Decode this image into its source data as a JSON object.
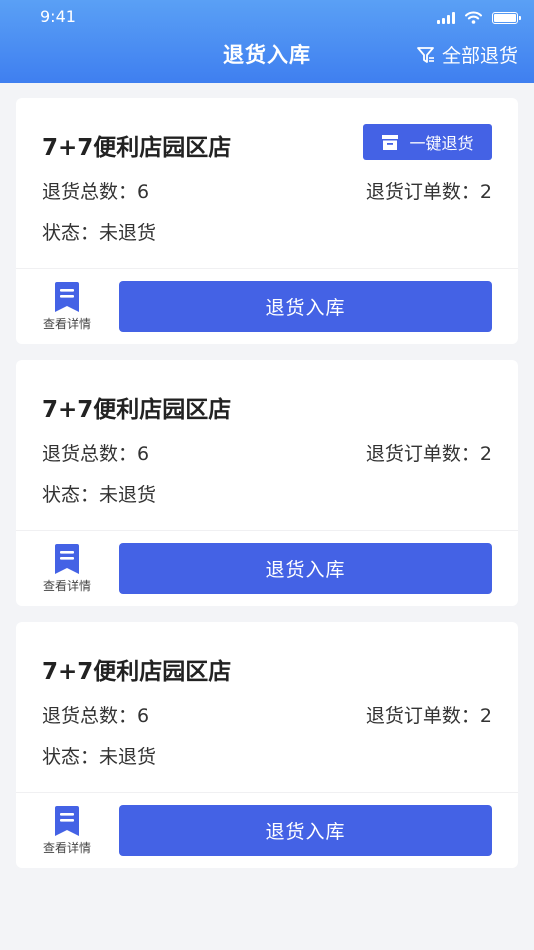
{
  "status_bar": {
    "time": "9:41"
  },
  "header": {
    "title": "退货入库",
    "action_label": "全部退货"
  },
  "labels": {
    "total_prefix": "退货总数：",
    "order_prefix": "退货订单数：",
    "status_prefix": "状态：",
    "quick_return": "一键退货",
    "detail": "查看详情",
    "stock_in": "退货入库"
  },
  "colors": {
    "header_top": "#5aa0f5",
    "header_bottom": "#3f7ff0",
    "accent": "#4462e5"
  },
  "stores": [
    {
      "name": "7+7便利店园区店",
      "total": "6",
      "orders": "2",
      "status": "未退货",
      "has_quick_return": true
    },
    {
      "name": "7+7便利店园区店",
      "total": "6",
      "orders": "2",
      "status": "未退货",
      "has_quick_return": false
    },
    {
      "name": "7+7便利店园区店",
      "total": "6",
      "orders": "2",
      "status": "未退货",
      "has_quick_return": false
    }
  ]
}
